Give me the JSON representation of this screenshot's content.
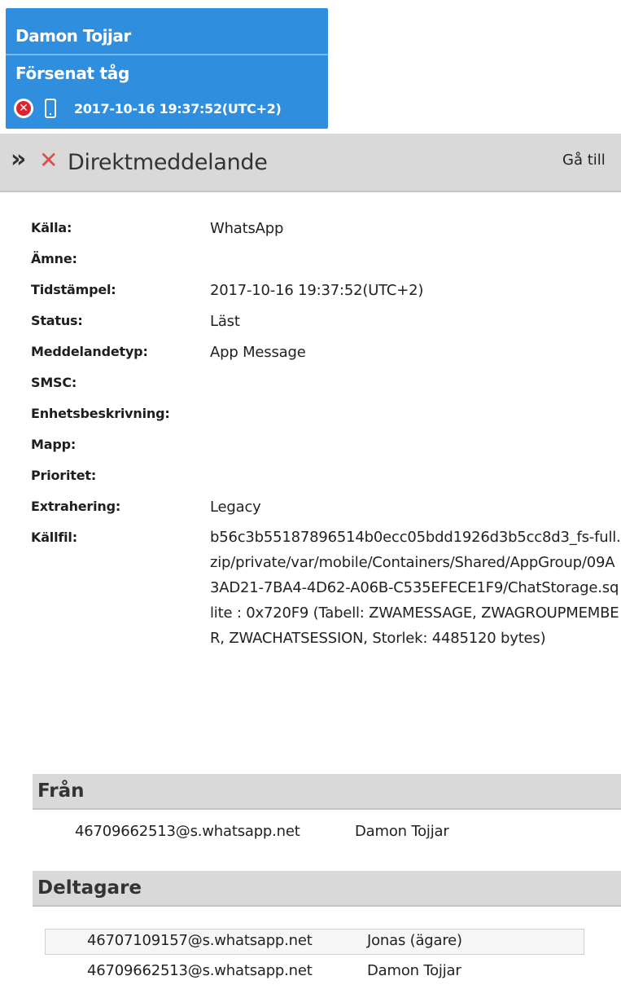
{
  "bubble": {
    "sender": "Damon Tojjar",
    "text": "Försenat tåg",
    "status_icon": "x-circle-icon",
    "device_icon": "phone-icon",
    "timestamp": "2017-10-16 19:37:52(UTC+2)",
    "background_color": "#2f8fde"
  },
  "header": {
    "expand_glyph": "»",
    "status_glyph": "✕",
    "title": "Direktmeddelande",
    "goto_label": "Gå till"
  },
  "fields": [
    {
      "label": "Källa:",
      "value": "WhatsApp"
    },
    {
      "label": "Ämne:",
      "value": ""
    },
    {
      "label": "Tidstämpel:",
      "value": "2017-10-16 19:37:52(UTC+2)"
    },
    {
      "label": "Status:",
      "value": "Läst"
    },
    {
      "label": "Meddelandetyp:",
      "value": "App Message"
    },
    {
      "label": "SMSC:",
      "value": ""
    },
    {
      "label": "Enhetsbeskrivning:",
      "value": ""
    },
    {
      "label": "Mapp:",
      "value": ""
    },
    {
      "label": "Prioritet:",
      "value": ""
    },
    {
      "label": "Extrahering:",
      "value": "Legacy"
    },
    {
      "label": "Källfil:",
      "value": "b56c3b55187896514b0ecc05bdd1926d3b5cc8d3_fs-full.zip/private/var/mobile/Containers/Shared/AppGroup/09A3AD21-7BA4-4D62-A06B-C535EFECE1F9/ChatStorage.sqlite : 0x720F9 (Tabell: ZWAMESSAGE, ZWAGROUPMEMBER, ZWACHATSESSION, Storlek: 4485120 bytes)"
    }
  ],
  "from_section": {
    "title": "Från",
    "entries": [
      {
        "address": "46709662513@s.whatsapp.net",
        "name": "Damon Tojjar"
      }
    ]
  },
  "participants_section": {
    "title": "Deltagare",
    "entries": [
      {
        "address": "46707109157@s.whatsapp.net",
        "name": "Jonas (ägare)"
      },
      {
        "address": "46709662513@s.whatsapp.net",
        "name": "Damon Tojjar"
      }
    ]
  }
}
